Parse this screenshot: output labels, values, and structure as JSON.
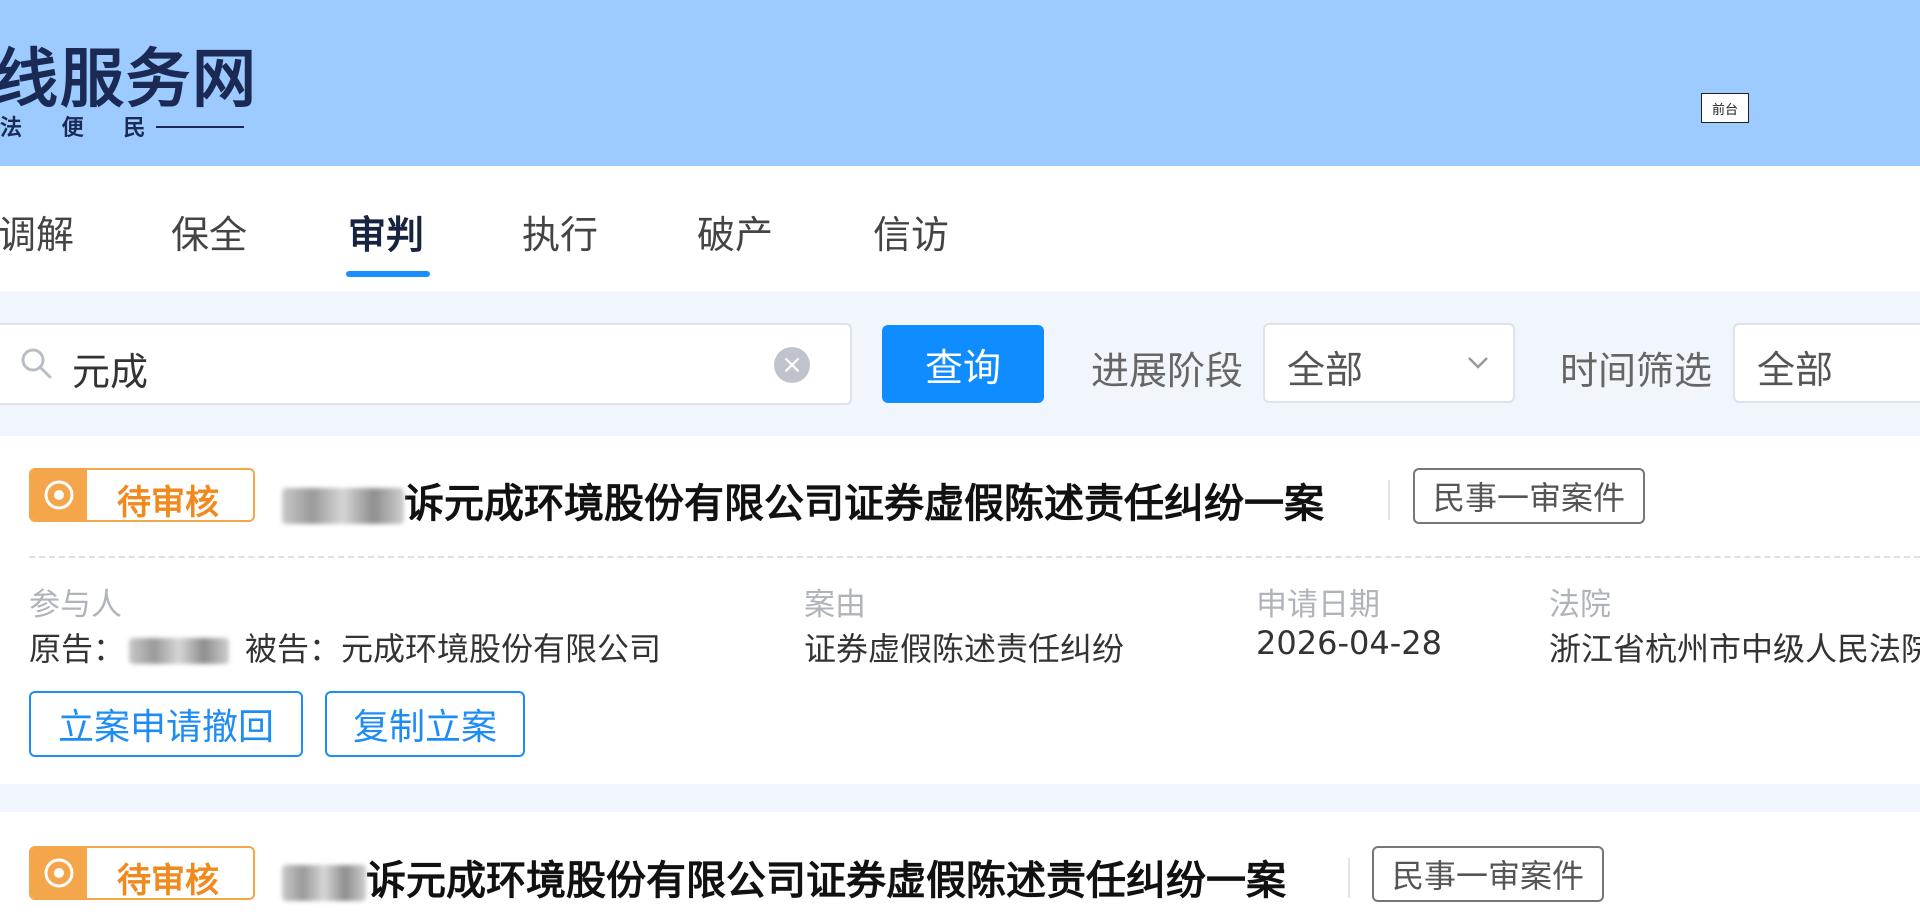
{
  "header": {
    "logo_title": "线服务网",
    "logo_subtitle": "法 便 民",
    "front_desk_button": "前台"
  },
  "tabs": [
    {
      "label": "调解",
      "active": false
    },
    {
      "label": "保全",
      "active": false
    },
    {
      "label": "审判",
      "active": true
    },
    {
      "label": "执行",
      "active": false
    },
    {
      "label": "破产",
      "active": false
    },
    {
      "label": "信访",
      "active": false
    }
  ],
  "search": {
    "value": "元成",
    "query_button": "查询"
  },
  "filters": {
    "progress_label": "进展阶段",
    "progress_value": "全部",
    "time_label": "时间筛选",
    "time_value": "全部"
  },
  "cases": [
    {
      "status": "待审核",
      "title": "诉元成环境股份有限公司证券虚假陈述责任纠纷一案",
      "type": "民事一审案件",
      "participants_label": "参与人",
      "plaintiff_prefix": "原告：",
      "defendant": "被告：元成环境股份有限公司",
      "cause_label": "案由",
      "cause": "证券虚假陈述责任纠纷",
      "date_label": "申请日期",
      "date": "2026-04-28",
      "court_label": "法院",
      "court": "浙江省杭州市中级人民法院",
      "actions": [
        "立案申请撤回",
        "复制立案"
      ]
    },
    {
      "status": "待审核",
      "title": "诉元成环境股份有限公司证券虚假陈述责任纠纷一案",
      "type": "民事一审案件"
    }
  ],
  "colors": {
    "header_bg": "#9dcbff",
    "accent": "#0f8cff",
    "status_orange": "#f5a54a"
  }
}
